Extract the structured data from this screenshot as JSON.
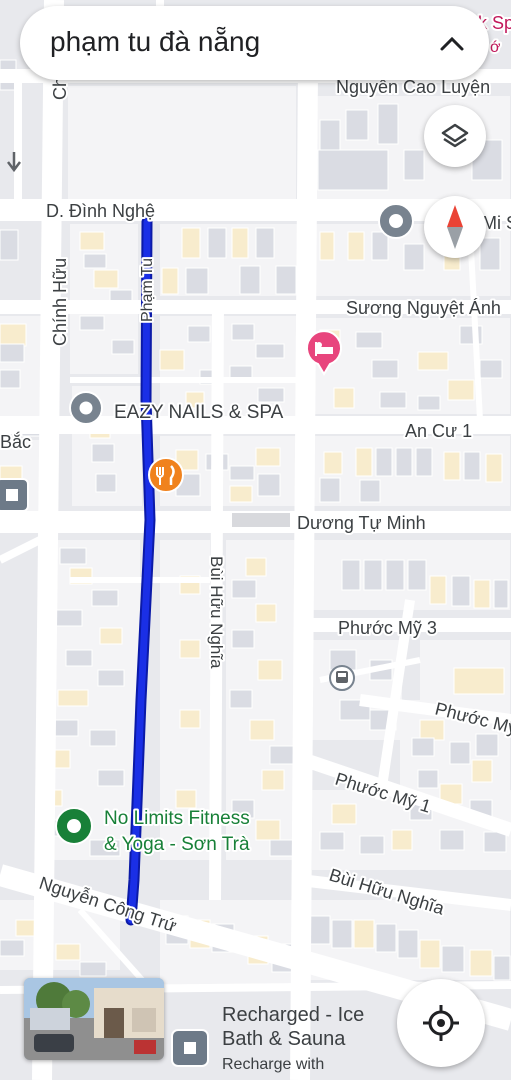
{
  "search": {
    "query": "phạm tu đà nẵng"
  },
  "streets": {
    "nguyen_cao_luyen": "Nguyễn Cao Luyện",
    "dinh_nghe": "D. Đình Nghệ",
    "chinh_huu": "Chính Hữu",
    "pham_tu": "Phạm Tu",
    "suong_nguyet_anh": "Sương Nguyệt Ánh",
    "an_cu_1": "An Cư 1",
    "duong_tu_minh": "Dương Tự Minh",
    "bui_huu_nghia": "Bùi Hữu Nghĩa",
    "phuoc_my_3": "Phước Mỹ 3",
    "phuoc_my": "Phước Mỹ",
    "phuoc_my_1": "Phước Mỹ 1",
    "bui_huu_nghia_2": "Bùi Hữu Nghĩa",
    "nguyen_cong_tru": "Nguyễn Công Trứ",
    "bac": "Bắc",
    "mi_s": "Mi S",
    "cut_top": "k Sp",
    "cut_top2": "ớ",
    "cut_ch": "Ch"
  },
  "pois": {
    "eazy_nails": "EAZY NAILS & SPA",
    "no_limits_line1": "No Limits Fitness",
    "no_limits_line2": "& Yoga - Sơn Trà"
  },
  "card": {
    "title": "Recharged - Ice Bath & Sauna",
    "subtitle": "Recharge with",
    "subtitle2": "Ice Bath & Sauna"
  },
  "colors": {
    "route": "#1a2fe6",
    "route_border": "#0b1aa8",
    "hotel_pin": "#e8457d",
    "restaurant_pin": "#f0821d",
    "green_pin": "#188038",
    "gray_pin": "#78838f"
  }
}
